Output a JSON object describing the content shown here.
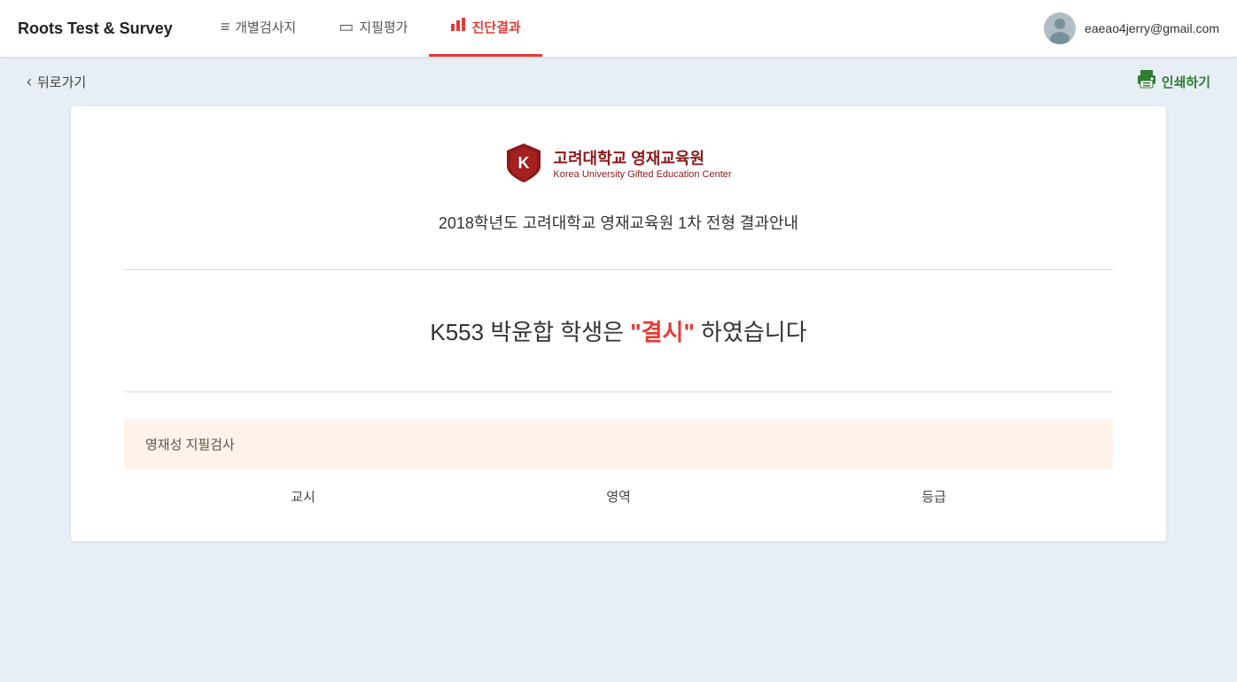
{
  "app": {
    "title": "Roots Test & Survey"
  },
  "header": {
    "nav": [
      {
        "id": "individual",
        "label": "개별검사지",
        "icon": "≡",
        "active": false
      },
      {
        "id": "written",
        "label": "지필평가",
        "icon": "▭",
        "active": false
      },
      {
        "id": "diagnosis",
        "label": "진단결과",
        "icon": "📊",
        "active": true
      }
    ],
    "user_email": "eaeao4jerry@gmail.com"
  },
  "toolbar": {
    "back_label": "뒤로가기",
    "print_label": "인쇄하기"
  },
  "result": {
    "org_name_kr": "고려대학교 영재교육원",
    "org_name_en": "Korea University Gifted Education Center",
    "announcement": "2018학년도 고려대학교 영재교육원 1차 전형 결과안내",
    "statement_prefix": "K553 박윤합 학생은 ",
    "result_word": "\"결시\"",
    "statement_suffix": " 하였습니다",
    "section_label": "영재성 지필검사",
    "table_headers": [
      "교시",
      "영역",
      "등급"
    ]
  }
}
